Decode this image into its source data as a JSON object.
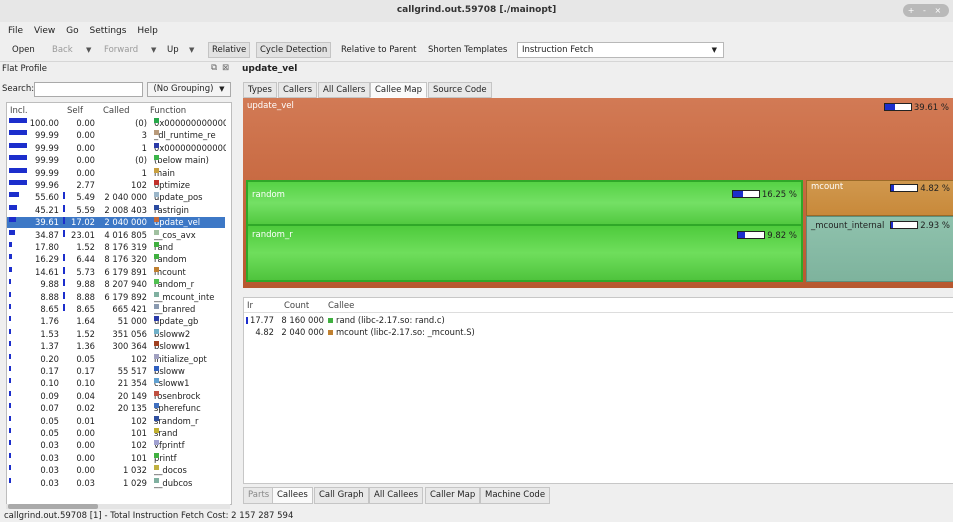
{
  "window": {
    "title": "callgrind.out.59708 [./mainopt]",
    "controls": "+ - ×"
  },
  "menu": [
    "File",
    "View",
    "Go",
    "Settings",
    "Help"
  ],
  "toolbar": {
    "open": "Open",
    "back": "Back",
    "forward": "Forward",
    "up": "Up",
    "relative": "Relative",
    "cycle_detection": "Cycle Detection",
    "relative_to_parent": "Relative to Parent",
    "shorten_templates": "Shorten Templates",
    "event_type": "Instruction Fetch"
  },
  "flat_profile": {
    "title": "Flat Profile",
    "search_label": "Search:",
    "search_value": "",
    "grouping": "(No Grouping)",
    "columns": [
      "Incl.",
      "Self",
      "Called",
      "Function"
    ],
    "rows": [
      {
        "incl": "100.00",
        "self": "0.00",
        "called": "(0)",
        "func": "0x000000000000",
        "color": "#27a84a"
      },
      {
        "incl": "99.99",
        "self": "0.00",
        "called": "3",
        "func": "_dl_runtime_re",
        "color": "#b89a7a"
      },
      {
        "incl": "99.99",
        "self": "0.00",
        "called": "1",
        "func": "0x000000000000",
        "color": "#2a3aa8"
      },
      {
        "incl": "99.99",
        "self": "0.00",
        "called": "(0)",
        "func": "(below main)",
        "color": "#3cb54a"
      },
      {
        "incl": "99.99",
        "self": "0.00",
        "called": "1",
        "func": "main",
        "color": "#c8a040"
      },
      {
        "incl": "99.96",
        "self": "2.77",
        "called": "102",
        "func": "optimize",
        "color": "#c0302a"
      },
      {
        "incl": "55.60",
        "self": "5.49",
        "called": "2 040 000",
        "func": "update_pos",
        "color": "#9ab5c8"
      },
      {
        "incl": "45.21",
        "self": "5.59",
        "called": "2 008 403",
        "func": "rastrigin",
        "color": "#2a4aa0"
      },
      {
        "incl": "39.61",
        "self": "17.02",
        "called": "2 040 000",
        "func": "update_vel",
        "color": "#c46a3a"
      },
      {
        "incl": "34.87",
        "self": "23.01",
        "called": "4 016 805",
        "func": "__cos_avx",
        "color": "#a0c0a0"
      },
      {
        "incl": "17.80",
        "self": "1.52",
        "called": "8 176 319",
        "func": "rand",
        "color": "#40b040"
      },
      {
        "incl": "16.29",
        "self": "6.44",
        "called": "8 176 320",
        "func": "random",
        "color": "#40b040"
      },
      {
        "incl": "14.61",
        "self": "5.73",
        "called": "6 179 891",
        "func": "mcount",
        "color": "#c08030"
      },
      {
        "incl": "9.88",
        "self": "9.88",
        "called": "8 207 940",
        "func": "random_r",
        "color": "#50c050"
      },
      {
        "incl": "8.88",
        "self": "8.88",
        "called": "6 179 892",
        "func": "__mcount_inte",
        "color": "#80b0a0"
      },
      {
        "incl": "8.65",
        "self": "8.65",
        "called": "665 421",
        "func": "__branred",
        "color": "#8a9ab0"
      },
      {
        "incl": "1.76",
        "self": "1.64",
        "called": "51 000",
        "func": "update_gb",
        "color": "#2a3aa8"
      },
      {
        "incl": "1.53",
        "self": "1.52",
        "called": "351 056",
        "func": "bsloww2",
        "color": "#70b0c8"
      },
      {
        "incl": "1.37",
        "self": "1.36",
        "called": "300 364",
        "func": "bsloww1",
        "color": "#a04020"
      },
      {
        "incl": "0.20",
        "self": "0.05",
        "called": "102",
        "func": "initialize_opt",
        "color": "#a0a0c0"
      },
      {
        "incl": "0.17",
        "self": "0.17",
        "called": "55 517",
        "func": "bsloww",
        "color": "#3060c0"
      },
      {
        "incl": "0.10",
        "self": "0.10",
        "called": "21 354",
        "func": "csloww1",
        "color": "#60a0d0"
      },
      {
        "incl": "0.09",
        "self": "0.04",
        "called": "20 149",
        "func": "rosenbrock",
        "color": "#c05040"
      },
      {
        "incl": "0.07",
        "self": "0.02",
        "called": "20 135",
        "func": "spherefunc",
        "color": "#4070c0"
      },
      {
        "incl": "0.05",
        "self": "0.01",
        "called": "102",
        "func": "srandom_r",
        "color": "#3050a0"
      },
      {
        "incl": "0.05",
        "self": "0.00",
        "called": "101",
        "func": "srand",
        "color": "#c0b030"
      },
      {
        "incl": "0.03",
        "self": "0.00",
        "called": "102",
        "func": "vfprintf",
        "color": "#a0a0d0"
      },
      {
        "incl": "0.03",
        "self": "0.00",
        "called": "101",
        "func": "printf",
        "color": "#40b040"
      },
      {
        "incl": "0.03",
        "self": "0.00",
        "called": "1 032",
        "func": "__docos",
        "color": "#c0b040"
      },
      {
        "incl": "0.03",
        "self": "0.03",
        "called": "1 029",
        "func": "__dubcos",
        "color": "#80b0a0"
      }
    ]
  },
  "detail": {
    "function_name": "update_vel",
    "top_tabs": [
      "Types",
      "Callers",
      "All Callers",
      "Callee Map",
      "Source Code"
    ],
    "treemap": {
      "root": {
        "label": "update_vel",
        "pct": "39.61 %",
        "frac": 0.4
      },
      "random": {
        "label": "random",
        "pct": "16.25 %",
        "frac": 0.4
      },
      "random_r": {
        "label": "random_r",
        "pct": "9.82 %",
        "frac": 0.25
      },
      "mcount": {
        "label": "mcount",
        "pct": "4.82 %",
        "frac": 0.12
      },
      "mcount_internal": {
        "label": "_mcount_internal",
        "pct": "2.93 %",
        "frac": 0.07
      }
    },
    "callees": {
      "columns": [
        "Ir",
        "Count",
        "Callee"
      ],
      "rows": [
        {
          "ir": "17.77",
          "count": "8 160 000",
          "callee": "rand (libc-2.17.so: rand.c)",
          "color": "#40b040",
          "bar": 0.18
        },
        {
          "ir": "4.82",
          "count": "2 040 000",
          "callee": "mcount (libc-2.17.so: _mcount.S)",
          "color": "#c08030",
          "bar": 0.0
        }
      ]
    },
    "bottom_tabs": [
      "Parts",
      "Callees",
      "Call Graph",
      "All Callees",
      "Caller Map",
      "Machine Code"
    ]
  },
  "status": "callgrind.out.59708 [1] - Total Instruction Fetch Cost: 2 157 287 594"
}
